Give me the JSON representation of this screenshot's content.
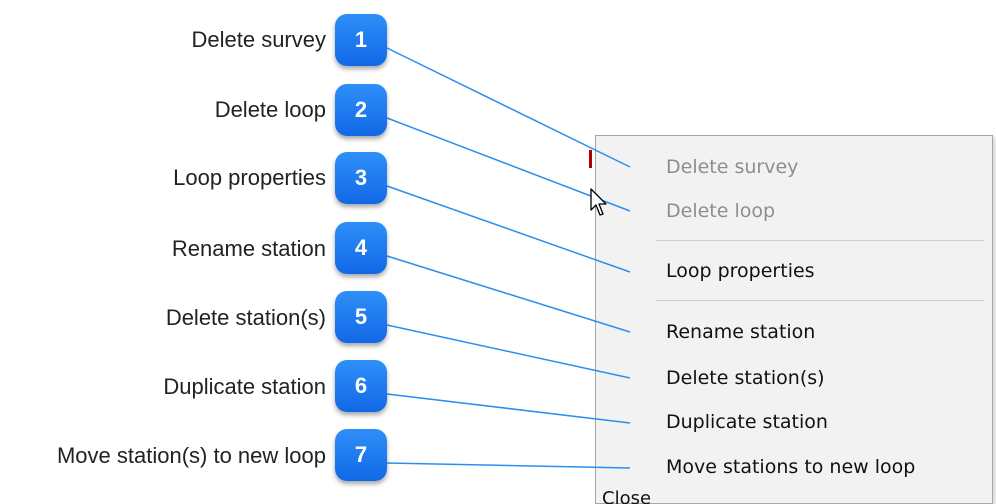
{
  "callouts": [
    {
      "number": "1",
      "label": "Delete survey"
    },
    {
      "number": "2",
      "label": "Delete loop"
    },
    {
      "number": "3",
      "label": "Loop properties"
    },
    {
      "number": "4",
      "label": "Rename station"
    },
    {
      "number": "5",
      "label": "Delete station(s)"
    },
    {
      "number": "6",
      "label": "Duplicate station"
    },
    {
      "number": "7",
      "label": "Move station(s) to new loop"
    }
  ],
  "context_menu": {
    "items": [
      {
        "label": "Delete survey",
        "enabled": false
      },
      {
        "label": "Delete loop",
        "enabled": false
      },
      {
        "label": "Loop properties",
        "enabled": true
      },
      {
        "label": "Rename station",
        "enabled": true
      },
      {
        "label": "Delete station(s)",
        "enabled": true
      },
      {
        "label": "Duplicate station",
        "enabled": true
      },
      {
        "label": "Move stations to new loop",
        "enabled": true
      }
    ]
  },
  "background": {
    "partial_text": "Close"
  },
  "colors": {
    "badge": "#1d7cf2",
    "leader_line": "#2b8ff0",
    "menu_bg": "#f2f2f2",
    "disabled_text": "#8e8e8e"
  },
  "icons": {
    "cursor": "arrow-pointer-icon"
  }
}
